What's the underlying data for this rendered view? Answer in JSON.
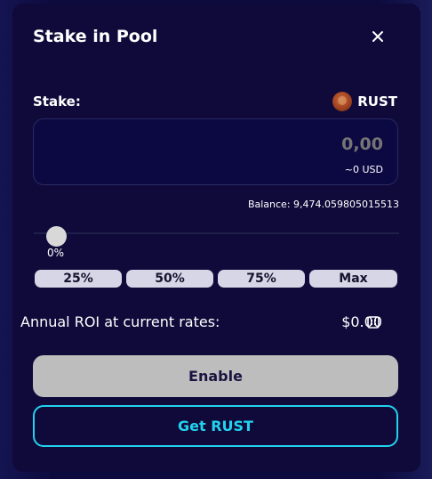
{
  "modal": {
    "title": "Stake in Pool",
    "close_icon": "close-icon"
  },
  "stake": {
    "label": "Stake:",
    "token": "RUST",
    "token_icon": "rust-token-icon",
    "input_value": "0,00",
    "usd_value": "~0 USD",
    "balance": "Balance: 9,474.059805015513"
  },
  "slider": {
    "percent_label": "0%",
    "value": 0
  },
  "percent_buttons": [
    "25%",
    "50%",
    "75%",
    "Max"
  ],
  "roi": {
    "label": "Annual ROI at current rates:",
    "value": "$0.00",
    "icon": "calculator-icon"
  },
  "actions": {
    "enable_label": "Enable",
    "get_label": "Get RUST"
  },
  "colors": {
    "background": "#0f0a3a",
    "accent": "#22d3ee",
    "disabled_button": "#bdbdbd"
  }
}
